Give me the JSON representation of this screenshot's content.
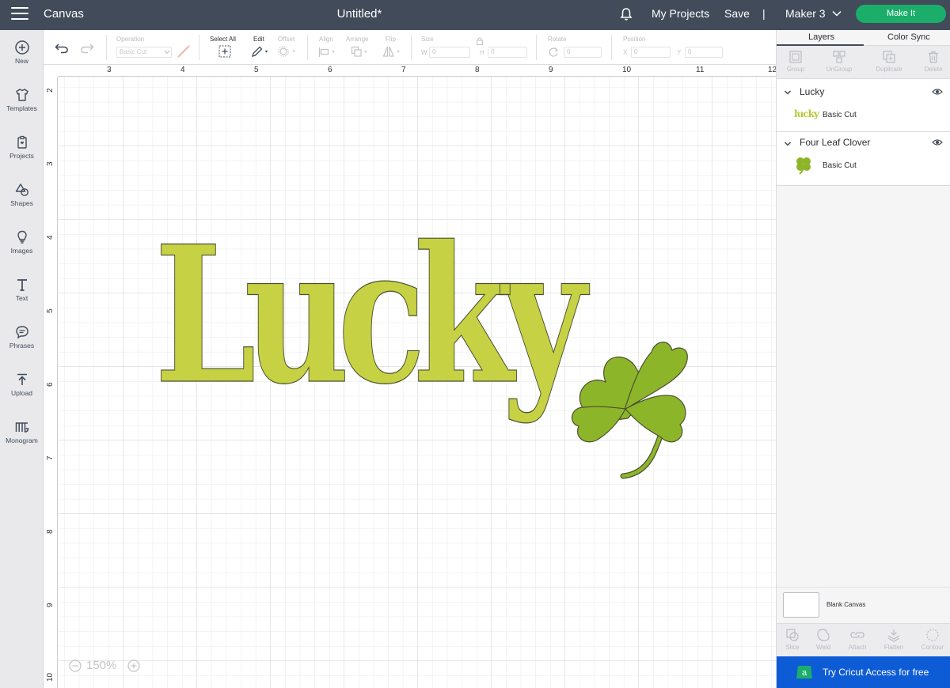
{
  "topbar": {
    "app_title": "Canvas",
    "doc_title": "Untitled*",
    "my_projects": "My Projects",
    "save": "Save",
    "separator": "|",
    "machine": "Maker 3",
    "make_it": "Make It",
    "bell_icon": "bell-icon",
    "menu_icon": "hamburger-icon"
  },
  "sidebar": {
    "items": [
      {
        "label": "New",
        "icon": "plus-circle-icon"
      },
      {
        "label": "Templates",
        "icon": "shirt-icon"
      },
      {
        "label": "Projects",
        "icon": "clipboard-icon"
      },
      {
        "label": "Shapes",
        "icon": "shapes-icon"
      },
      {
        "label": "Images",
        "icon": "bulb-icon"
      },
      {
        "label": "Text",
        "icon": "text-icon"
      },
      {
        "label": "Phrases",
        "icon": "speech-bubble-icon"
      },
      {
        "label": "Upload",
        "icon": "upload-icon"
      },
      {
        "label": "Monogram",
        "icon": "monogram-icon"
      }
    ]
  },
  "toolbar": {
    "operation_label": "Operation",
    "operation_value": "Basic Cut",
    "select_all_label": "Select All",
    "edit_label": "Edit",
    "offset_label": "Offset",
    "align_label": "Align",
    "arrange_label": "Arrange",
    "flip_label": "Flip",
    "size_label": "Size",
    "size_w": "W",
    "size_h": "H",
    "size_w_value": "0",
    "size_h_value": "0",
    "rotate_label": "Rotate",
    "rotate_value": "0",
    "position_label": "Position",
    "pos_x": "X",
    "pos_y": "Y",
    "pos_x_value": "0",
    "pos_y_value": "0"
  },
  "canvas": {
    "ruler_h": [
      "3",
      "4",
      "5",
      "6",
      "7",
      "8",
      "9",
      "10",
      "11",
      "12"
    ],
    "ruler_v": [
      "2",
      "3",
      "4",
      "5",
      "6",
      "7",
      "8",
      "9",
      "10"
    ],
    "zoom": "150%",
    "design_text": "Lucky",
    "text_color": "#c6d144",
    "clover_color": "#8db52a",
    "outline_color": "#4a5030"
  },
  "rightpanel": {
    "tabs": [
      "Layers",
      "Color Sync"
    ],
    "actions": [
      {
        "label": "Group",
        "icon": "group-icon"
      },
      {
        "label": "UnGroup",
        "icon": "ungroup-icon"
      },
      {
        "label": "Duplicate",
        "icon": "duplicate-icon"
      },
      {
        "label": "Delete",
        "icon": "trash-icon"
      }
    ],
    "layers": [
      {
        "name": "Lucky",
        "thumb_text": "lucky",
        "operation": "Basic Cut"
      },
      {
        "name": "Four Leaf Clover",
        "operation": "Basic Cut"
      }
    ],
    "blank_canvas": "Blank Canvas",
    "bottom_actions": [
      {
        "label": "Slice",
        "icon": "slice-icon"
      },
      {
        "label": "Weld",
        "icon": "weld-icon"
      },
      {
        "label": "Attach",
        "icon": "attach-icon"
      },
      {
        "label": "Flatten",
        "icon": "flatten-icon"
      },
      {
        "label": "Contour",
        "icon": "contour-icon"
      }
    ],
    "access_banner": "Try Cricut Access for free",
    "access_badge": "a"
  }
}
